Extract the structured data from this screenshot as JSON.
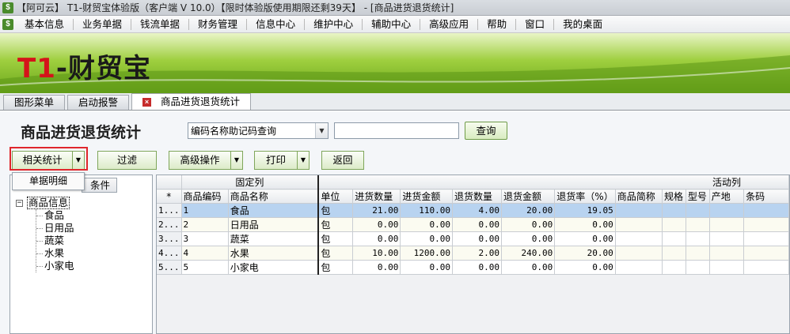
{
  "window": {
    "title": "【阿可云】 T1-财贸宝体验版（客户端 V 10.0）【限时体验版使用期限还剩39天】 - [商品进货退货统计]"
  },
  "menubar": {
    "items": [
      "基本信息",
      "业务单据",
      "钱流单据",
      "财务管理",
      "信息中心",
      "维护中心",
      "辅助中心",
      "高级应用",
      "帮助",
      "窗口",
      "我的桌面"
    ]
  },
  "banner": {
    "logo_t1": "T1",
    "logo_dash": "-",
    "logo_name": "财贸宝"
  },
  "tabs": [
    {
      "label": "图形菜单",
      "active": false
    },
    {
      "label": "启动报警",
      "active": false
    },
    {
      "label": "商品进货退货统计",
      "active": true
    }
  ],
  "page": {
    "title": "商品进货退货统计",
    "search_mode": "编码名称助记码查询",
    "search_value": "",
    "query_label": "查询"
  },
  "toolbar": {
    "related_stats": "相关统计",
    "filter": "过滤",
    "advanced": "高级操作",
    "print": "打印",
    "back": "返回"
  },
  "dropdown": {
    "item": "单据明细"
  },
  "left_panel": {
    "tab_label": "条件",
    "tree_root": "商品信息",
    "tree_children": [
      "食品",
      "日用品",
      "蔬菜",
      "水果",
      "小家电"
    ]
  },
  "grid": {
    "group_fixed": "固定列",
    "group_active": "活动列",
    "star": "*",
    "columns": [
      "商品编码",
      "商品名称",
      "单位",
      "进货数量",
      "进货金额",
      "退货数量",
      "退货金额",
      "退货率（%）",
      "商品简称",
      "规格",
      "型号",
      "产地",
      "条码"
    ],
    "rows": [
      {
        "no": "1...",
        "code": "1",
        "name": "食品",
        "unit": "包",
        "in_qty": "21.00",
        "in_amt": "110.00",
        "ret_qty": "4.00",
        "ret_amt": "20.00",
        "ret_rate": "19.05"
      },
      {
        "no": "2...",
        "code": "2",
        "name": "日用品",
        "unit": "包",
        "in_qty": "0.00",
        "in_amt": "0.00",
        "ret_qty": "0.00",
        "ret_amt": "0.00",
        "ret_rate": "0.00"
      },
      {
        "no": "3...",
        "code": "3",
        "name": "蔬菜",
        "unit": "包",
        "in_qty": "0.00",
        "in_amt": "0.00",
        "ret_qty": "0.00",
        "ret_amt": "0.00",
        "ret_rate": "0.00"
      },
      {
        "no": "4...",
        "code": "4",
        "name": "水果",
        "unit": "包",
        "in_qty": "10.00",
        "in_amt": "1200.00",
        "ret_qty": "2.00",
        "ret_amt": "240.00",
        "ret_rate": "20.00"
      },
      {
        "no": "5...",
        "code": "5",
        "name": "小家电",
        "unit": "包",
        "in_qty": "0.00",
        "in_amt": "0.00",
        "ret_qty": "0.00",
        "ret_amt": "0.00",
        "ret_rate": "0.00"
      }
    ]
  },
  "colors": {
    "brand_red": "#d4141a",
    "banner_green": "#6aa61a",
    "highlight_red": "#e0262c",
    "selected_row": "#b8d3f0"
  }
}
